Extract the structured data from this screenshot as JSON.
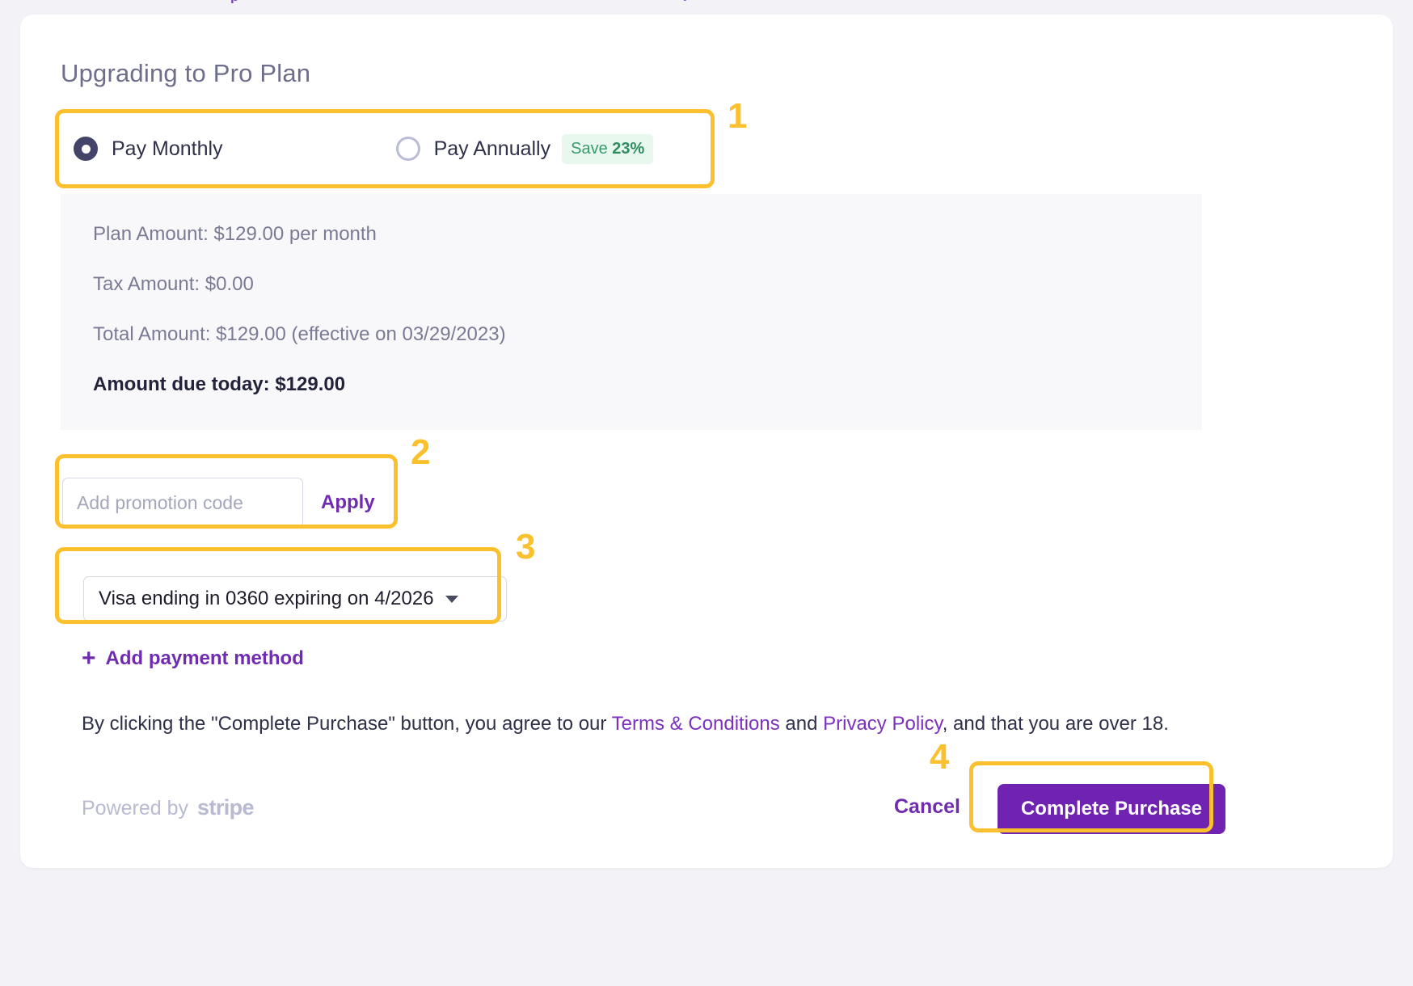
{
  "page": {
    "title": "Upgrading to Pro Plan",
    "cutoff_fragments": [
      "p",
      "l"
    ]
  },
  "billing_cycle": {
    "monthly": {
      "label": "Pay Monthly",
      "selected": true
    },
    "annual": {
      "label": "Pay Annually",
      "selected": false,
      "badge_prefix": "Save ",
      "badge_value": "23%"
    }
  },
  "summary": {
    "plan_amount": "Plan Amount: $129.00 per month",
    "tax_amount": "Tax Amount: $0.00",
    "total_amount": "Total Amount: $129.00 (effective on 03/29/2023)",
    "amount_due_today": "Amount due today: $129.00"
  },
  "promotion": {
    "placeholder": "Add promotion code",
    "value": "",
    "apply_label": "Apply"
  },
  "payment_method": {
    "selected": "Visa ending in 0360 expiring on 4/2026",
    "add_label": "Add payment method"
  },
  "terms": {
    "part1": "By clicking the \"Complete Purchase\" button, you agree to our ",
    "link1": "Terms & Conditions",
    "part2": " and ",
    "link2": "Privacy Policy",
    "part3": ", and that you are over 18."
  },
  "footer": {
    "powered_by": "Powered by",
    "stripe": "stripe",
    "cancel_label": "Cancel",
    "complete_label": "Complete Purchase"
  },
  "annotations": {
    "one": "1",
    "two": "2",
    "three": "3",
    "four": "4"
  },
  "colors": {
    "accent_purple": "#6f23b0",
    "annotation_yellow": "#fbc02d",
    "badge_green": "#3a9a6b",
    "badge_bg": "#e9f8ef",
    "card_bg": "#ffffff",
    "page_bg": "#f3f3f7",
    "summary_bg": "#f8f8fb"
  }
}
